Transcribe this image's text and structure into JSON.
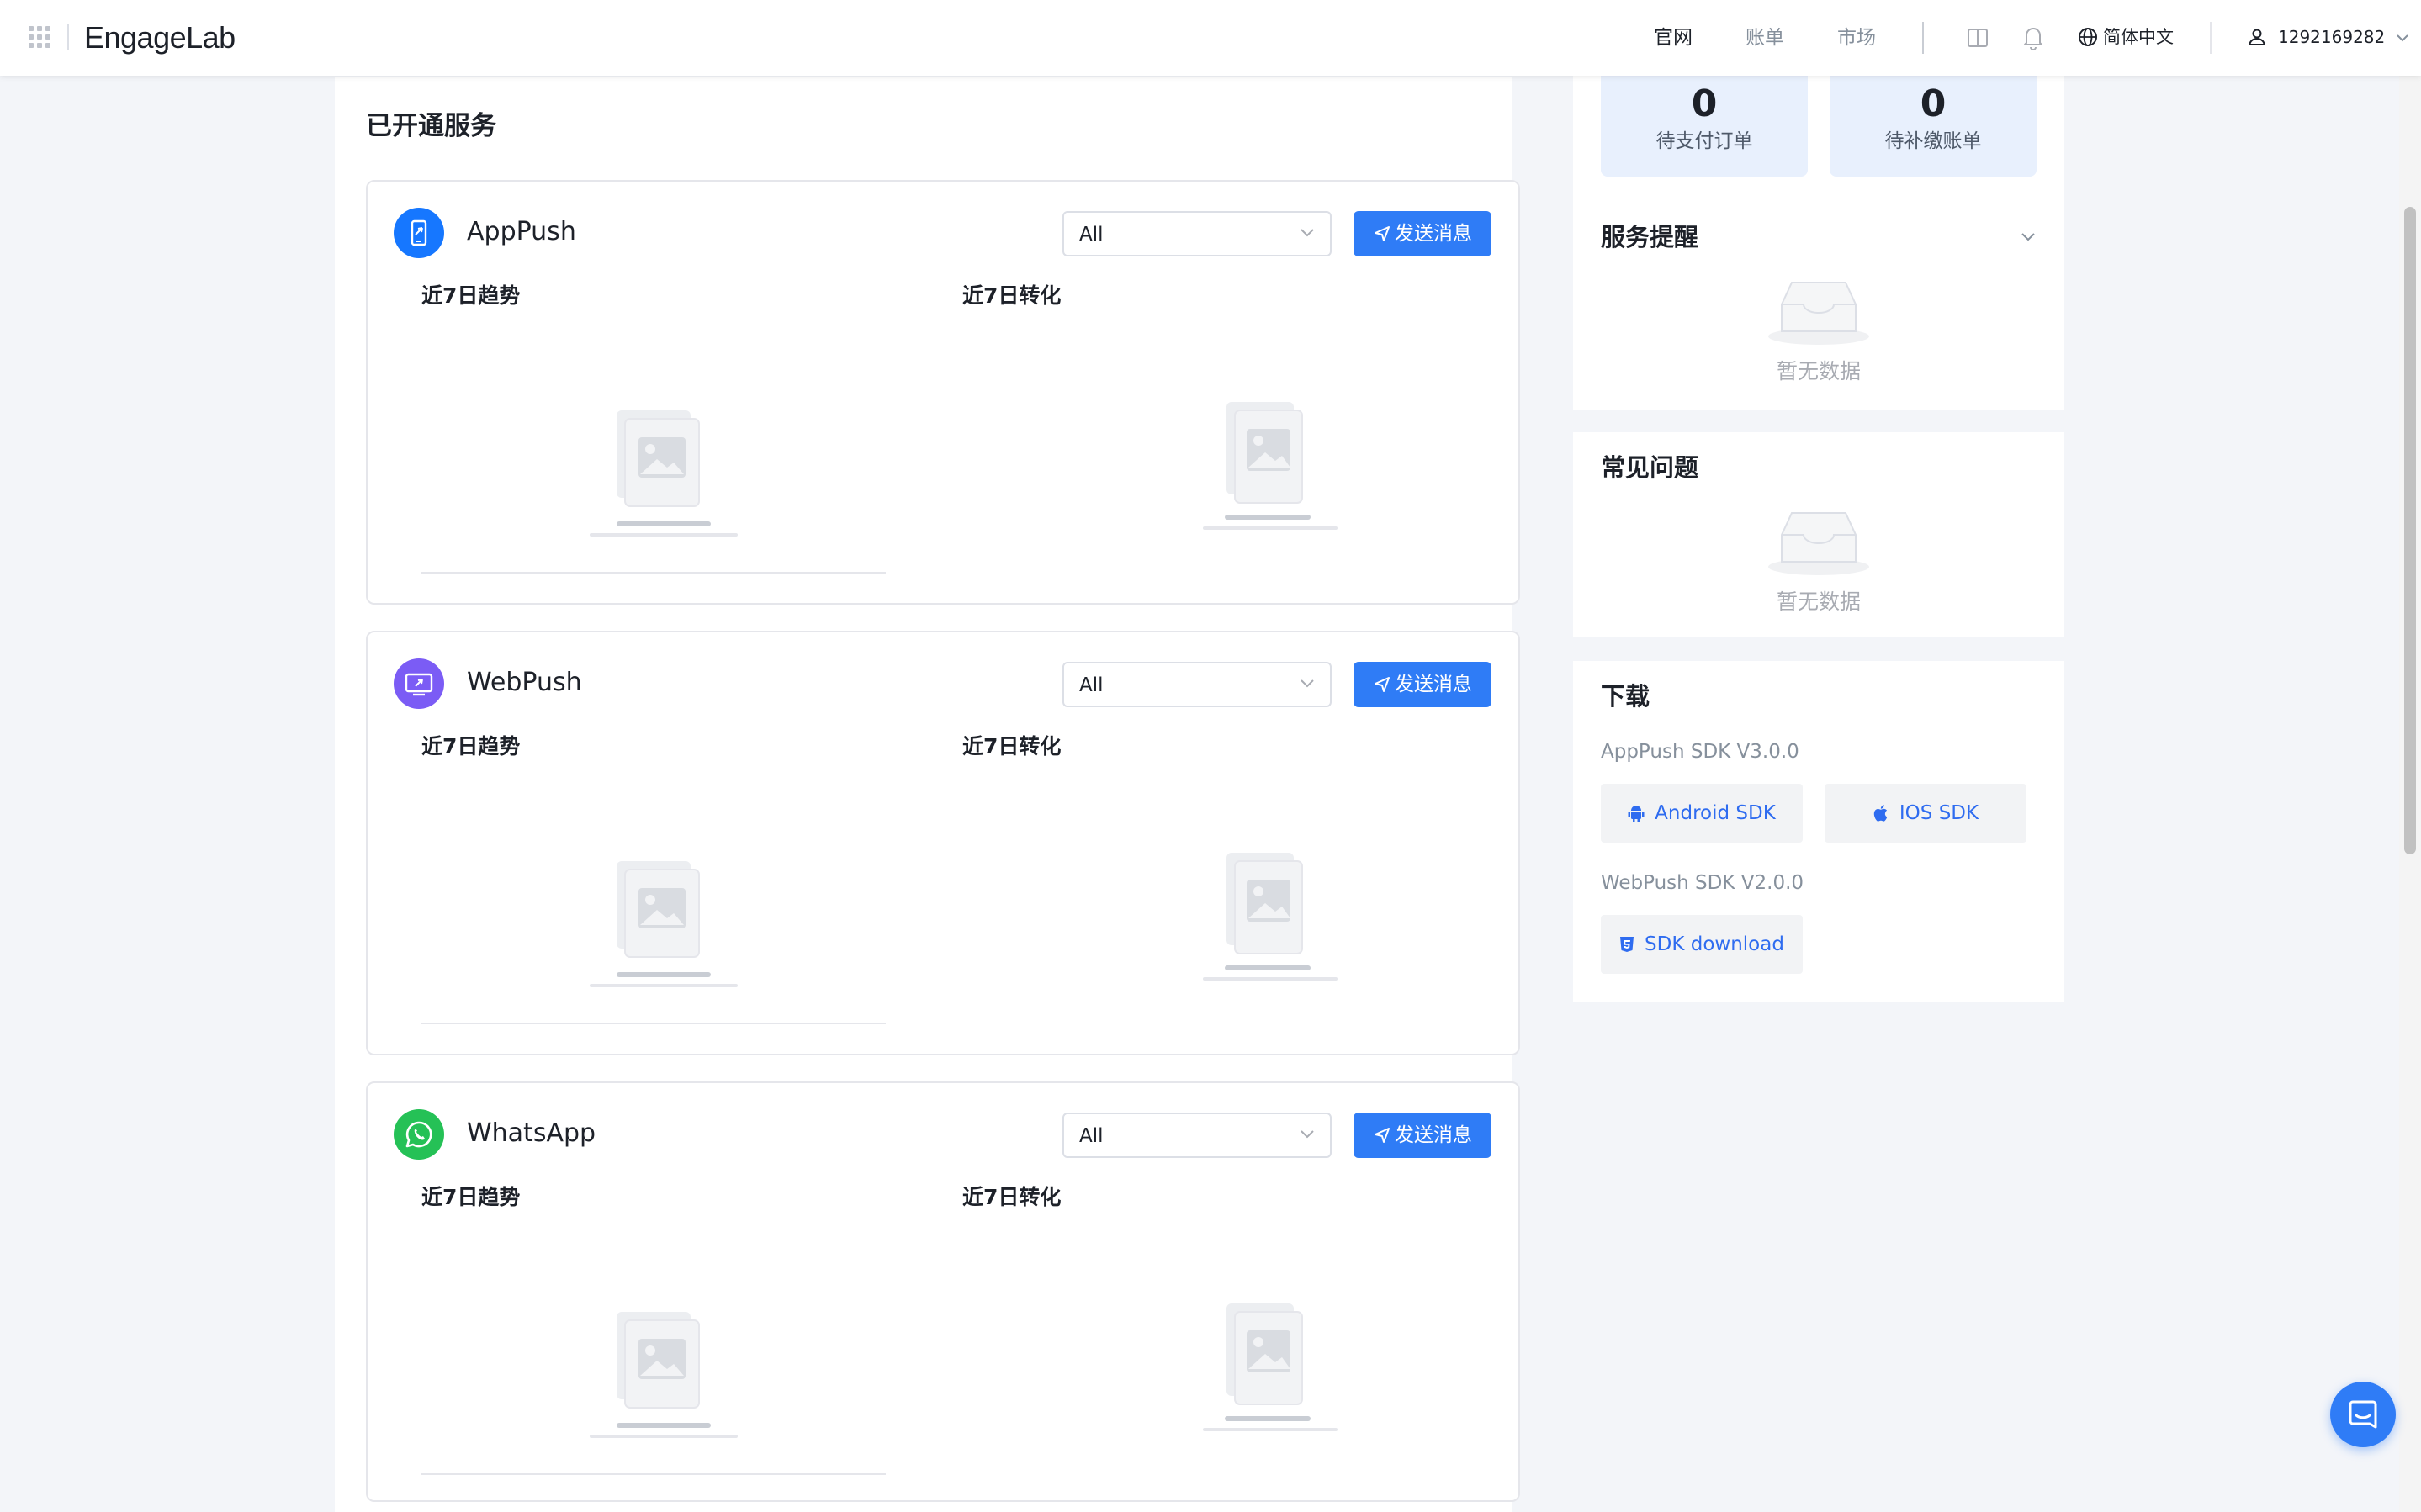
{
  "brand": {
    "logo_part1": "Engage",
    "logo_part2": "Lab"
  },
  "nav": {
    "official": "官网",
    "billing": "账单",
    "market": "市场",
    "language": "简体中文",
    "user_id": "1292169282"
  },
  "main": {
    "section_title": "已开通服务",
    "services": [
      {
        "name": "AppPush",
        "filter_value": "All",
        "send_label": "发送消息",
        "trend_label": "近7日趋势",
        "conversion_label": "近7日转化",
        "icon": "mobile-send-icon",
        "color": "#1677ff"
      },
      {
        "name": "WebPush",
        "filter_value": "All",
        "send_label": "发送消息",
        "trend_label": "近7日趋势",
        "conversion_label": "近7日转化",
        "icon": "monitor-send-icon",
        "color": "#7b5cf5"
      },
      {
        "name": "WhatsApp",
        "filter_value": "All",
        "send_label": "发送消息",
        "trend_label": "近7日趋势",
        "conversion_label": "近7日转化",
        "icon": "whatsapp-icon",
        "color": "#25c156"
      }
    ]
  },
  "sidebar": {
    "stats": [
      {
        "value": "0",
        "label": "待支付订单"
      },
      {
        "value": "0",
        "label": "待补缴账单"
      }
    ],
    "reminders": {
      "title": "服务提醒",
      "empty": "暂无数据"
    },
    "faq": {
      "title": "常见问题",
      "empty": "暂无数据"
    },
    "download": {
      "title": "下载",
      "apppush_sdk": "AppPush SDK V3.0.0",
      "android_btn": "Android SDK",
      "ios_btn": "IOS SDK",
      "webpush_sdk": "WebPush SDK V2.0.0",
      "web_btn": "SDK download"
    }
  },
  "colors": {
    "primary": "#2f7cf6",
    "background": "#f3f5f9",
    "stat_bg": "#e8f0fd"
  }
}
